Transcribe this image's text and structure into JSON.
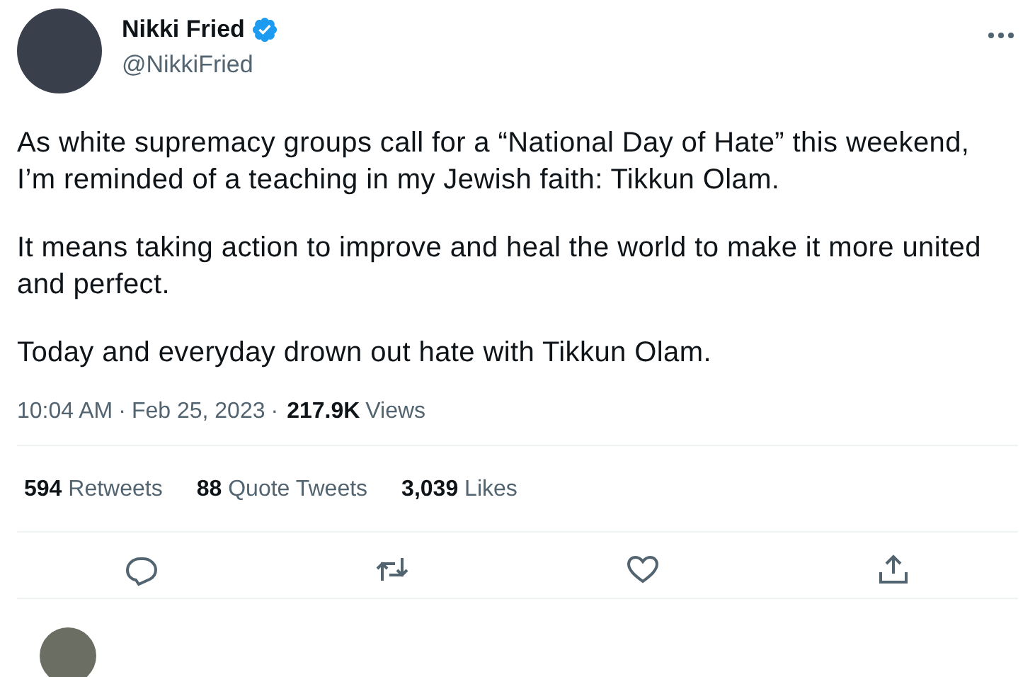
{
  "author": {
    "name": "Nikki Fried",
    "handle": "@NikkiFried",
    "verified": true
  },
  "tweet": {
    "paragraphs": [
      "As white supremacy groups call for a “National Day of Hate” this weekend, I’m reminded of a teaching in my Jewish faith: Tikkun Olam.",
      "It means taking action to improve and heal the world to make it more united and perfect.",
      "Today and everyday drown out hate with Tikkun Olam."
    ],
    "time": "10:04 AM",
    "separator_1": "·",
    "date": "Feb 25, 2023",
    "separator_2": "·",
    "views_count": "217.9K",
    "views_label": "Views"
  },
  "stats": [
    {
      "count": "594",
      "label": "Retweets"
    },
    {
      "count": "88",
      "label": "Quote Tweets"
    },
    {
      "count": "3,039",
      "label": "Likes"
    }
  ],
  "actions": [
    {
      "kind": "reply"
    },
    {
      "kind": "retweet"
    },
    {
      "kind": "like"
    },
    {
      "kind": "share"
    }
  ]
}
